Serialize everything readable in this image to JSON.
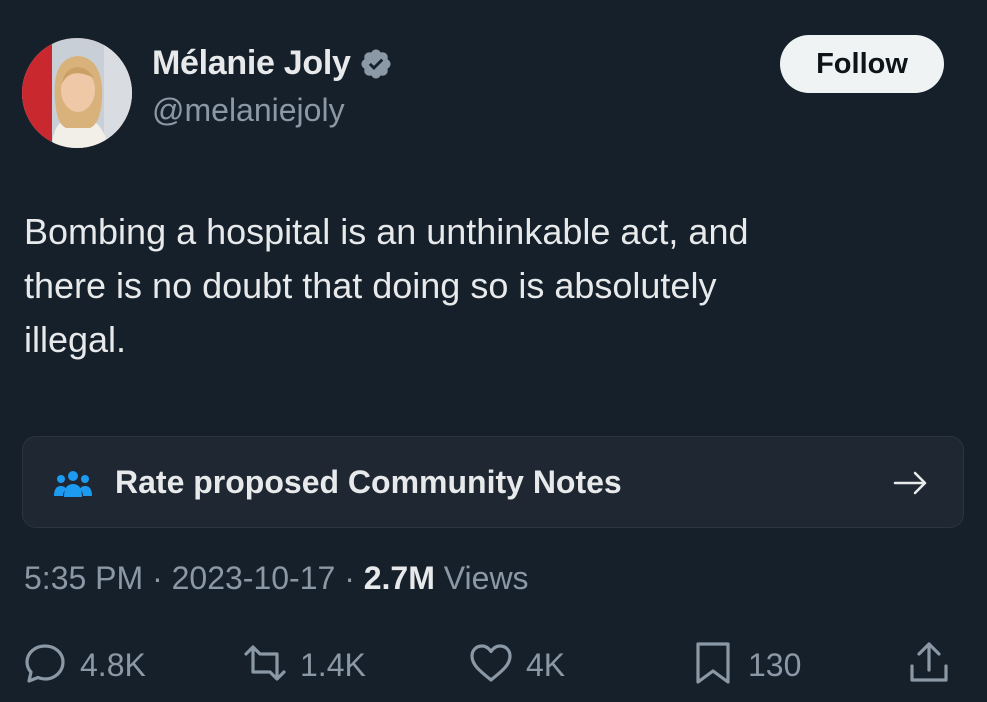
{
  "author": {
    "name": "Mélanie Joly",
    "handle": "@melaniejoly",
    "verified": true
  },
  "follow_label": "Follow",
  "tweet_text": "Bombing a hospital is an unthinkable act, and\nthere is no doubt that doing so is absolutely\nillegal.",
  "community_notes": {
    "label": "Rate proposed Community Notes",
    "icon": "people-icon",
    "arrow": "arrow-right-icon"
  },
  "meta": {
    "time": "5:35 PM",
    "sep1": " · ",
    "date": "2023-10-17",
    "sep2": " · ",
    "views_count": "2.7M",
    "views_label": " Views"
  },
  "actions": {
    "replies": "4.8K",
    "reposts": "1.4K",
    "likes": "4K",
    "bookmarks": "130"
  },
  "colors": {
    "background": "#15202b",
    "text": "#e7e9ea",
    "secondary": "#8b98a5",
    "accent": "#1d9bf0"
  }
}
